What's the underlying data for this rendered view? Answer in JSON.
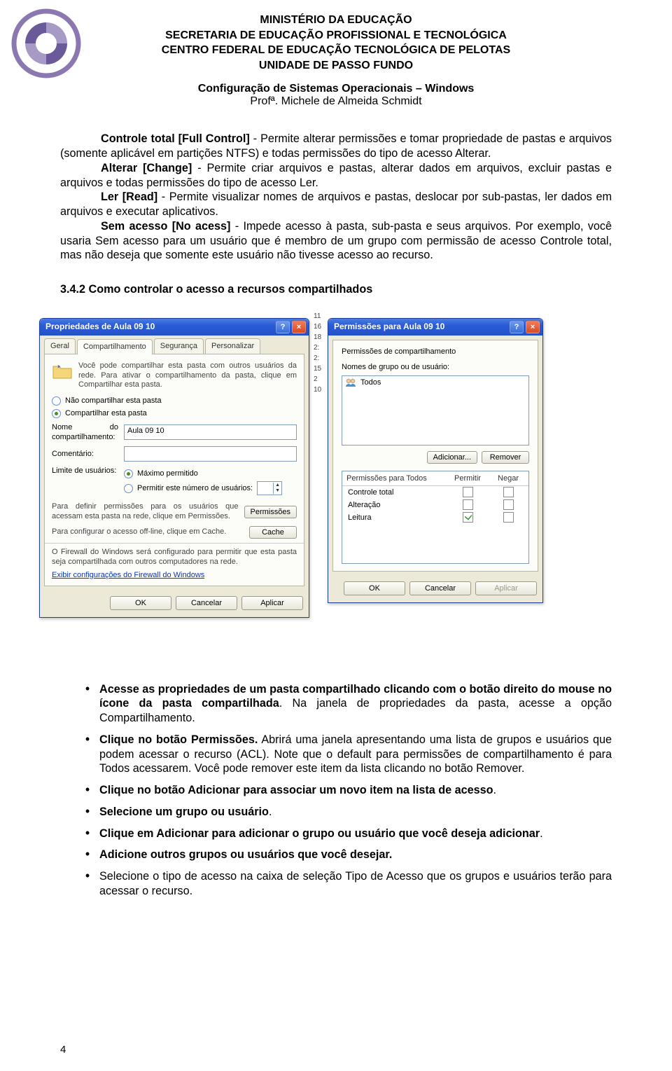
{
  "header": {
    "l1": "MINISTÉRIO DA EDUCAÇÃO",
    "l2": "SECRETARIA DE EDUCAÇÃO PROFISSIONAL E TECNOLÓGICA",
    "l3": "CENTRO FEDERAL DE EDUCAÇÃO TECNOLÓGICA DE PELOTAS",
    "l4": "UNIDADE DE PASSO FUNDO",
    "sub_bold": "Configuração de Sistemas Operacionais – Windows",
    "sub_line": "Profª. Michele de Almeida Schmidt"
  },
  "paras": {
    "p1a": "Controle total [Full Control]",
    "p1b": " - Permite alterar permissões e tomar propriedade de pastas e arquivos (somente aplicável em partições NTFS) e todas permissões do tipo de acesso Alterar.",
    "p2a": "Alterar [Change]",
    "p2b": " - Permite criar arquivos e pastas, alterar dados em arquivos, excluir pastas e arquivos e todas permissões do tipo de acesso Ler.",
    "p3a": "Ler [Read]",
    "p3b": " - Permite visualizar nomes de arquivos e pastas, deslocar por sub-pastas, ler dados em arquivos e executar aplicativos.",
    "p4a": "Sem acesso [No acess]",
    "p4b": " - Impede acesso à pasta, sub-pasta e seus arquivos. Por exemplo, você usaria Sem acesso para um usuário que é membro de um grupo com permissão de acesso Controle total, mas não deseja que somente este usuário não tivesse acesso ao recurso."
  },
  "h32": "3.4.2 Como controlar o acesso a recursos compartilhados",
  "timecol": [
    "11",
    "16",
    "18",
    "2:",
    "2:",
    "15",
    "2",
    "10"
  ],
  "win1": {
    "title": "Propriedades de Aula 09 10",
    "tabs": [
      "Geral",
      "Compartilhamento",
      "Segurança",
      "Personalizar"
    ],
    "desc": "Você pode compartilhar esta pasta com outros usuários da rede. Para ativar o compartilhamento da pasta, clique em Compartilhar esta pasta.",
    "r1": "Não compartilhar esta pasta",
    "r2": "Compartilhar esta pasta",
    "name_lbl": "Nome do compartilhamento:",
    "name_val": "Aula 09 10",
    "comment_lbl": "Comentário:",
    "limit_lbl": "Limite de usuários:",
    "lim_r1": "Máximo permitido",
    "lim_r2": "Permitir este número de usuários:",
    "perm_desc": "Para definir permissões para os usuários que acessam esta pasta na rede, clique em Permissões.",
    "perm_btn": "Permissões",
    "cache_desc": "Para configurar o acesso off-line, clique em Cache.",
    "cache_btn": "Cache",
    "fw_note": "O Firewall do Windows será configurado para permitir que esta pasta seja compartilhada com outros computadores na rede.",
    "fw_link": "Exibir configurações do Firewall do Windows",
    "ok": "OK",
    "cancel": "Cancelar",
    "apply": "Aplicar"
  },
  "win2": {
    "title": "Permissões para Aula 09 10",
    "group_lbl": "Permissões de compartilhamento",
    "names_lbl": "Nomes de grupo ou de usuário:",
    "item": "Todos",
    "add": "Adicionar...",
    "remove": "Remover",
    "perms_for": "Permissões para Todos",
    "col_allow": "Permitir",
    "col_deny": "Negar",
    "rows": [
      "Controle total",
      "Alteração",
      "Leitura"
    ],
    "ok": "OK",
    "cancel": "Cancelar",
    "apply": "Aplicar"
  },
  "bullets": [
    {
      "b": "Acesse as propriedades de um pasta compartilhado clicando com o botão direito do mouse no ícone da pasta compartilhada",
      "r": ". Na janela de propriedades da pasta, acesse a opção Compartilhamento."
    },
    {
      "b": "Clique no botão Permissões.",
      "r": " Abrirá uma janela apresentando uma lista de grupos e usuários que podem acessar o recurso (ACL). Note que o default para permissões de compartilhamento é para Todos acessarem. Você pode remover este item da lista clicando no botão Remover."
    },
    {
      "b": "Clique no botão Adicionar para associar um novo item na lista de acesso",
      "r": "."
    },
    {
      "b": "Selecione um grupo ou usuário",
      "r": "."
    },
    {
      "b": "Clique em Adicionar para adicionar o grupo ou usuário que você deseja adicionar",
      "r": "."
    },
    {
      "b": "Adicione outros grupos ou usuários que você desejar.",
      "r": ""
    },
    {
      "pre": "Selecione o tipo de acesso na caixa de seleção Tipo de Acesso que os grupos e usuários terão para acessar o recurso."
    }
  ],
  "pagenum": "4"
}
